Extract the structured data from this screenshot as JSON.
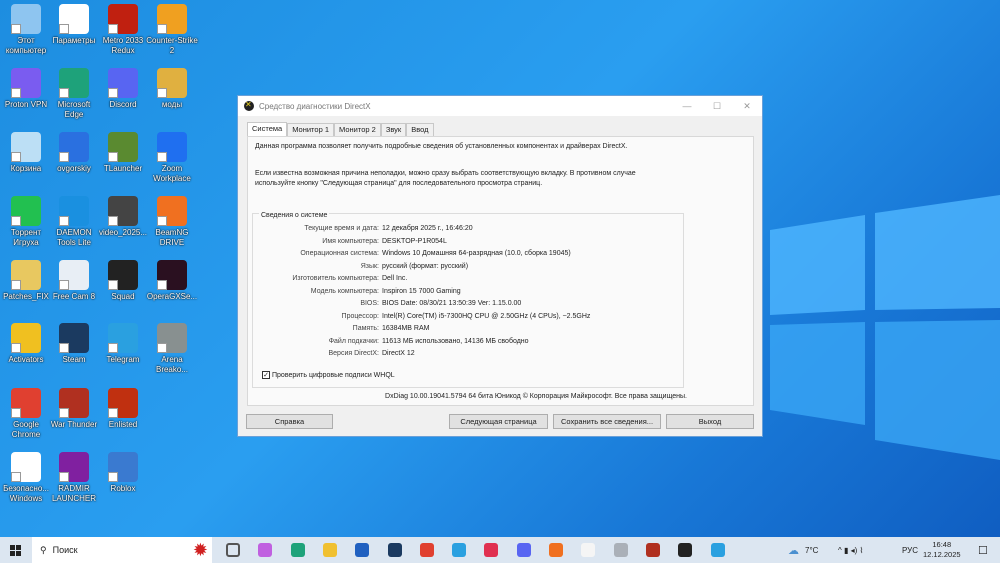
{
  "desktop": {
    "icons": [
      {
        "label": "Этот компьютер",
        "color": "#8ec5f0"
      },
      {
        "label": "Параметры",
        "color": "#ffffff"
      },
      {
        "label": "Metro 2033 Redux",
        "color": "#c02010"
      },
      {
        "label": "Counter-Strike 2",
        "color": "#f0a020"
      },
      {
        "label": "Proton VPN",
        "color": "#7a5cf0"
      },
      {
        "label": "Microsoft Edge",
        "color": "#1ea27a"
      },
      {
        "label": "Discord",
        "color": "#5865f2"
      },
      {
        "label": "моды",
        "color": "#e0b040"
      },
      {
        "label": "Корзина",
        "color": "#bcdff5"
      },
      {
        "label": "ovgorskiy",
        "color": "#2a70e0"
      },
      {
        "label": "TLauncher",
        "color": "#5a8a30"
      },
      {
        "label": "Zoom Workplace",
        "color": "#1f6ff0"
      },
      {
        "label": "Торрент Игруха",
        "color": "#22c050"
      },
      {
        "label": "DAEMON Tools Lite",
        "color": "#1a90e0"
      },
      {
        "label": "video_2025...",
        "color": "#444444"
      },
      {
        "label": "BeamNG DRIVE",
        "color": "#f07020"
      },
      {
        "label": "Patches_FIX",
        "color": "#e8c860"
      },
      {
        "label": "Free Cam 8",
        "color": "#e8eef5"
      },
      {
        "label": "Squad",
        "color": "#222222"
      },
      {
        "label": "OperaGXSe...",
        "color": "#2a1020"
      },
      {
        "label": "Activators",
        "color": "#f0c020"
      },
      {
        "label": "Steam",
        "color": "#1b3a60"
      },
      {
        "label": "Telegram",
        "color": "#2aa0e0"
      },
      {
        "label": "Arena Breako...",
        "color": "#889090"
      },
      {
        "label": "Google Chrome",
        "color": "#e04030"
      },
      {
        "label": "War Thunder",
        "color": "#b03020"
      },
      {
        "label": "Enlisted",
        "color": "#c03010"
      },
      null,
      {
        "label": "Безопасно... Windows",
        "color": "#ffffff"
      },
      {
        "label": "RADMIR LAUNCHER",
        "color": "#8020a0"
      },
      {
        "label": "Roblox",
        "color": "#3a7ad0"
      }
    ]
  },
  "dialog": {
    "title": "Средство диагностики DirectX",
    "controls": {
      "minimize": "—",
      "maximize": "☐",
      "close": "✕"
    },
    "tabs": [
      "Система",
      "Монитор 1",
      "Монитор 2",
      "Звук",
      "Ввод"
    ],
    "intro1": "Данная программа позволяет получить подробные сведения об установленных компонентах и драйверах DirectX.",
    "intro2": "Если известна возможная причина неполадки, можно сразу выбрать соответствующую вкладку. В противном случае используйте кнопку \"Следующая страница\" для последовательного просмотра страниц.",
    "group_title": "Сведения о системе",
    "rows": [
      {
        "k": "Текущие время и дата:",
        "v": "12 декабря 2025 г., 16:46:20"
      },
      {
        "k": "Имя компьютера:",
        "v": "DESKTOP-P1R054L"
      },
      {
        "k": "Операционная система:",
        "v": "Windows 10 Домашняя 64-разрядная (10.0, сборка 19045)"
      },
      {
        "k": "Язык:",
        "v": "русский (формат: русский)"
      },
      {
        "k": "Изготовитель компьютера:",
        "v": "Dell Inc."
      },
      {
        "k": "Модель компьютера:",
        "v": "Inspiron 15 7000 Gaming"
      },
      {
        "k": "BIOS:",
        "v": "BIOS Date: 08/30/21 13:50:39 Ver: 1.15.0.00"
      },
      {
        "k": "Процессор:",
        "v": "Intel(R) Core(TM) i5-7300HQ CPU @ 2.50GHz (4 CPUs), ~2.5GHz"
      },
      {
        "k": "Память:",
        "v": "16384MB RAM"
      },
      {
        "k": "Файл подкачки:",
        "v": "11613 МБ использовано, 14136 МБ свободно"
      },
      {
        "k": "Версия DirectX:",
        "v": "DirectX 12"
      }
    ],
    "whql_label": "Проверить цифровые подписи WHQL",
    "whql_checked": true,
    "footer": "DxDiag 10.00.19041.5794 64 бита Юникод © Корпорация Майкрософт. Все права защищены.",
    "buttons": {
      "help": "Справка",
      "next": "Следующая страница",
      "save": "Сохранить все сведения...",
      "exit": "Выход"
    }
  },
  "taskbar": {
    "search_placeholder": "Поиск",
    "weather": "7°C",
    "lang": "РУС",
    "time": "16:48",
    "date": "12.12.2025",
    "apps": [
      {
        "name": "task-view",
        "color": "#555555"
      },
      {
        "name": "copilot",
        "color": "#c060e0"
      },
      {
        "name": "edge",
        "color": "#1ea27a"
      },
      {
        "name": "explorer",
        "color": "#f0c030"
      },
      {
        "name": "store",
        "color": "#2060c0"
      },
      {
        "name": "steam",
        "color": "#1b3a60"
      },
      {
        "name": "chrome",
        "color": "#e04030"
      },
      {
        "name": "telegram",
        "color": "#2aa0e0"
      },
      {
        "name": "opera",
        "color": "#e03050"
      },
      {
        "name": "discord",
        "color": "#5865f2"
      },
      {
        "name": "beamng",
        "color": "#f07020"
      },
      {
        "name": "document",
        "color": "#f5f5f5"
      },
      {
        "name": "app-gray",
        "color": "#aab0b8"
      },
      {
        "name": "war-thunder",
        "color": "#b03020"
      },
      {
        "name": "directx",
        "color": "#222222"
      },
      {
        "name": "telegram-2",
        "color": "#2aa0e0"
      }
    ]
  }
}
